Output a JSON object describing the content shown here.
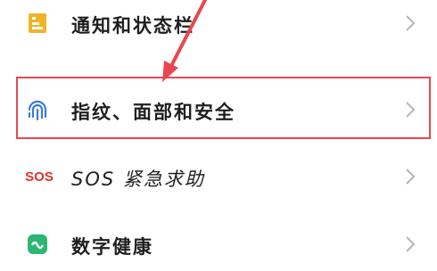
{
  "settings_list": {
    "items": [
      {
        "label": "通知和状态栏",
        "icon": "notification-status-icon"
      },
      {
        "label": "指纹、面部和安全",
        "icon": "fingerprint-icon"
      },
      {
        "label": "SOS 紧急求助",
        "icon": "sos-icon",
        "icon_text": "SOS"
      },
      {
        "label": "数字健康",
        "icon": "digital-wellbeing-icon"
      }
    ]
  },
  "colors": {
    "notify_icon": "#f0b429",
    "fingerprint_icon": "#3a7bd5",
    "sos_icon": "#e0322f",
    "digital_icon": "#2bb673",
    "highlight": "#e8474f",
    "arrow": "#e8474f",
    "chevron": "#b5b5b5"
  }
}
